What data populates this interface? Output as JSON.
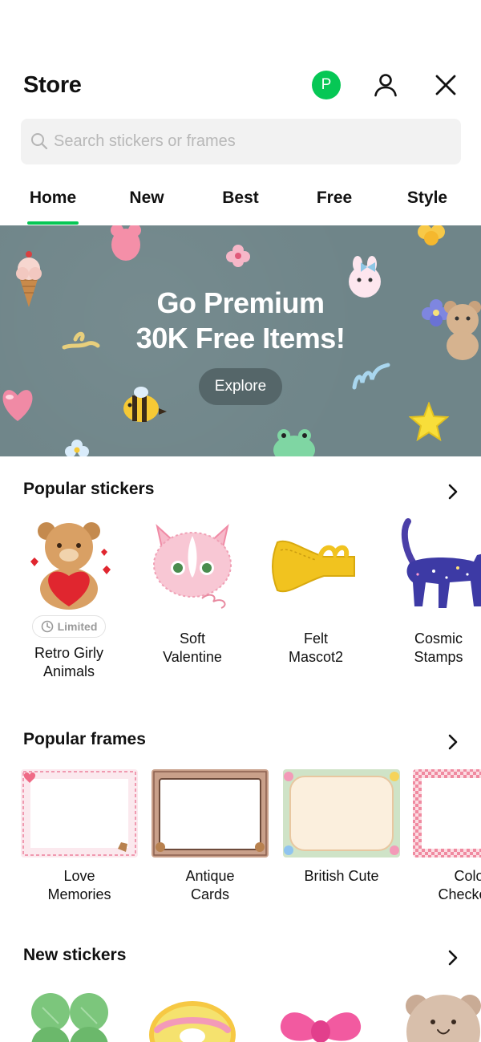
{
  "header": {
    "title": "Store",
    "badge_letter": "P"
  },
  "search": {
    "placeholder": "Search stickers or frames"
  },
  "tabs": [
    {
      "label": "Home",
      "active": true
    },
    {
      "label": "New"
    },
    {
      "label": "Best"
    },
    {
      "label": "Free"
    },
    {
      "label": "Style"
    }
  ],
  "banner": {
    "line1": "Go Premium",
    "line2": "30K Free Items!",
    "button": "Explore"
  },
  "popular_stickers": {
    "title": "Popular stickers",
    "items": [
      {
        "name_line1": "Retro Girly",
        "name_line2": "Animals",
        "badge": "Limited",
        "art": "bear-heart"
      },
      {
        "name_line1": "Soft",
        "name_line2": "Valentine",
        "art": "pink-cat"
      },
      {
        "name_line1": "Felt",
        "name_line2": "Mascot2",
        "art": "felt-horn"
      },
      {
        "name_line1": "Cosmic",
        "name_line2": "Stamps",
        "art": "cosmic-cat"
      }
    ]
  },
  "popular_frames": {
    "title": "Popular frames",
    "items": [
      {
        "name_line1": "Love",
        "name_line2": "Memories",
        "art": "heart-lace-frame"
      },
      {
        "name_line1": "Antique",
        "name_line2": "Cards",
        "art": "antique-frame"
      },
      {
        "name_line1": "British Cute",
        "name_line2": "",
        "art": "floral-frame"
      },
      {
        "name_line1": "Color",
        "name_line2": "Checker F",
        "art": "checker-frame"
      }
    ]
  },
  "new_stickers": {
    "title": "New stickers",
    "items": [
      {
        "art": "clover"
      },
      {
        "art": "donut"
      },
      {
        "art": "pink-bow"
      },
      {
        "art": "bear-face"
      }
    ]
  },
  "colors": {
    "accent": "#06c755",
    "banner_bg": "#6f8589",
    "search_bg": "#f2f2f2"
  }
}
